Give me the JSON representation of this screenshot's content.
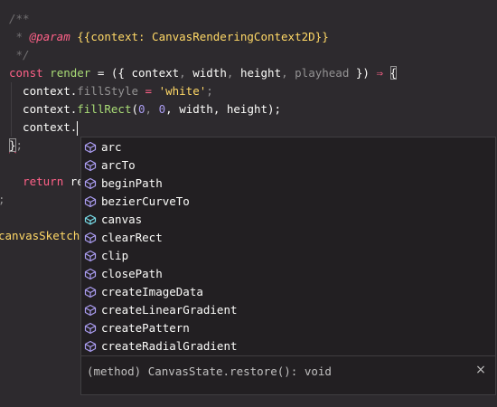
{
  "editor": {
    "lines": [
      {
        "tokens": [
          {
            "t": "/**",
            "c": "c-comment"
          }
        ]
      },
      {
        "tokens": [
          {
            "t": " * ",
            "c": "c-comment"
          },
          {
            "t": "@param",
            "c": "c-red",
            "it": true
          },
          {
            "t": " ",
            "c": "c-comment"
          },
          {
            "t": "{{context: CanvasRenderingContext2D}}",
            "c": "c-yellow",
            "it": false
          }
        ]
      },
      {
        "tokens": [
          {
            "t": " */",
            "c": "c-comment"
          }
        ]
      },
      {
        "tokens": [
          {
            "t": "const",
            "c": "c-red"
          },
          {
            "t": " ",
            "c": "c-white"
          },
          {
            "t": "render",
            "c": "c-green"
          },
          {
            "t": " = ({ ",
            "c": "c-white"
          },
          {
            "t": "context",
            "c": "c-white"
          },
          {
            "t": ", ",
            "c": "c-gray"
          },
          {
            "t": "width",
            "c": "c-white"
          },
          {
            "t": ", ",
            "c": "c-gray"
          },
          {
            "t": "height",
            "c": "c-white"
          },
          {
            "t": ", ",
            "c": "c-gray"
          },
          {
            "t": "playhead",
            "c": "c-gray"
          },
          {
            "t": " }) ",
            "c": "c-white"
          },
          {
            "t": "⇒",
            "c": "c-red"
          },
          {
            "t": " ",
            "c": "c-white"
          },
          {
            "t": "{",
            "c": "c-white",
            "box": true
          }
        ]
      },
      {
        "tokens": [
          {
            "t": "  context.",
            "c": "c-white"
          },
          {
            "t": "fillStyle",
            "c": "c-gray"
          },
          {
            "t": " = ",
            "c": "c-red"
          },
          {
            "t": "'white'",
            "c": "c-yellow"
          },
          {
            "t": ";",
            "c": "c-gray"
          }
        ]
      },
      {
        "tokens": [
          {
            "t": "  context.",
            "c": "c-white"
          },
          {
            "t": "fillRect",
            "c": "c-green"
          },
          {
            "t": "(",
            "c": "c-white"
          },
          {
            "t": "0",
            "c": "c-purple"
          },
          {
            "t": ", ",
            "c": "c-gray"
          },
          {
            "t": "0",
            "c": "c-purple"
          },
          {
            "t": ", width, height);",
            "c": "c-white"
          }
        ]
      },
      {
        "tokens": [
          {
            "t": "  context.",
            "c": "c-white",
            "cursor": true
          }
        ]
      },
      {
        "tokens": [
          {
            "t": "}",
            "c": "c-white",
            "box": true,
            "squiggle": true
          },
          {
            "t": ";",
            "c": "c-gray"
          }
        ]
      },
      {
        "tokens": [
          {
            "t": "",
            "c": "c-white"
          }
        ]
      },
      {
        "tokens": [
          {
            "t": "  ",
            "c": "c-white"
          },
          {
            "t": "return",
            "c": "c-red"
          },
          {
            "t": " ren",
            "c": "c-white"
          }
        ]
      },
      {
        "tokens": [
          {
            "t": ";",
            "c": "c-gray"
          }
        ]
      },
      {
        "tokens": [
          {
            "t": "",
            "c": "c-white"
          }
        ]
      },
      {
        "tokens": [
          {
            "t": "canvasSketch",
            "c": "c-yellow"
          }
        ]
      }
    ]
  },
  "suggest": {
    "items": [
      {
        "label": "arc",
        "kind": "method"
      },
      {
        "label": "arcTo",
        "kind": "method"
      },
      {
        "label": "beginPath",
        "kind": "method"
      },
      {
        "label": "bezierCurveTo",
        "kind": "method"
      },
      {
        "label": "canvas",
        "kind": "field"
      },
      {
        "label": "clearRect",
        "kind": "method"
      },
      {
        "label": "clip",
        "kind": "method"
      },
      {
        "label": "closePath",
        "kind": "method"
      },
      {
        "label": "createImageData",
        "kind": "method"
      },
      {
        "label": "createLinearGradient",
        "kind": "method"
      },
      {
        "label": "createPattern",
        "kind": "method"
      },
      {
        "label": "createRadialGradient",
        "kind": "method"
      }
    ],
    "details": "(method) CanvasState.restore(): void",
    "close_label": "×"
  },
  "colors": {
    "background": "#2d2a2e",
    "widget_background": "#221f22",
    "method_icon": "#ab9df2",
    "field_icon": "#78dce8"
  }
}
